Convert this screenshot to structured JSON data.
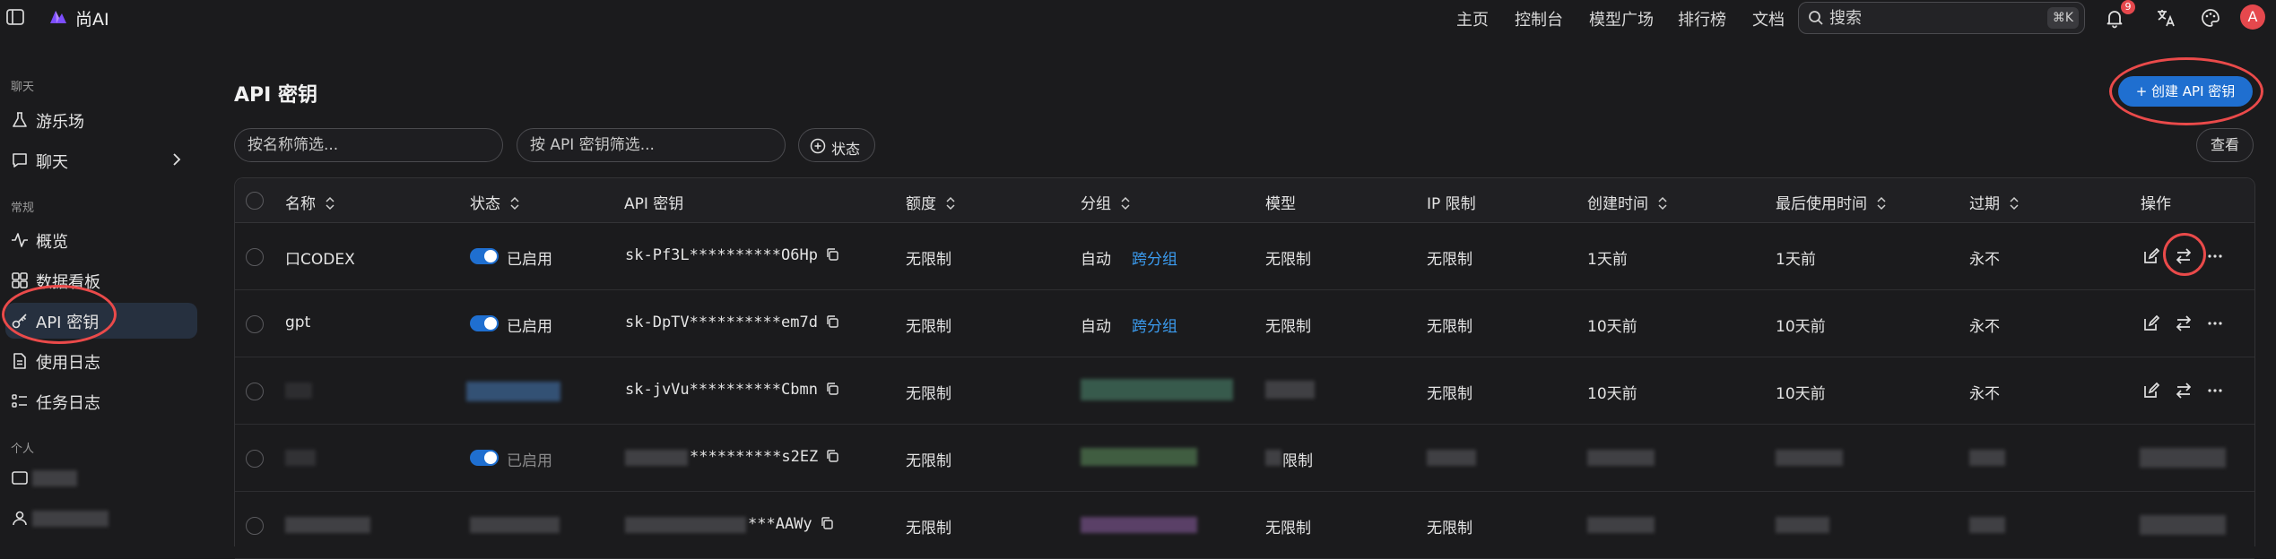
{
  "app": {
    "name": "尚AI"
  },
  "nav": [
    "主页",
    "控制台",
    "模型广场",
    "排行榜",
    "文档"
  ],
  "search": {
    "placeholder": "搜索",
    "shortcut": "⌘K"
  },
  "notifications": {
    "count": "9"
  },
  "user": {
    "avatar_letter": "A"
  },
  "sidebar": {
    "sections": {
      "chat": "聊天",
      "general": "常规",
      "personal": "个人"
    },
    "items": [
      {
        "label": "游乐场",
        "icon": "flask-icon"
      },
      {
        "label": "聊天",
        "icon": "chat-icon"
      },
      {
        "label": "概览",
        "icon": "activity-icon"
      },
      {
        "label": "数据看板",
        "icon": "dashboard-icon"
      },
      {
        "label": "API 密钥",
        "icon": "key-icon"
      },
      {
        "label": "使用日志",
        "icon": "log-icon"
      },
      {
        "label": "任务日志",
        "icon": "task-list-icon"
      }
    ]
  },
  "page": {
    "title": "API 密钥",
    "create_button": "+ 创建 API 密钥",
    "filters": {
      "name_placeholder": "按名称筛选...",
      "key_placeholder": "按 API 密钥筛选...",
      "status_label": "状态"
    },
    "view_button": "查看"
  },
  "table": {
    "columns": [
      "名称",
      "状态",
      "API 密钥",
      "额度",
      "分组",
      "模型",
      "IP 限制",
      "创建时间",
      "最后使用时间",
      "过期",
      "操作"
    ],
    "rows": [
      {
        "name": "口CODEX",
        "status": "已启用",
        "key": "sk-Pf3L**********O6Hp",
        "quota": "无限制",
        "group": "自动",
        "group_link": "跨分组",
        "model": "无限制",
        "ip": "无限制",
        "created": "1天前",
        "last_used": "1天前",
        "expires": "永不"
      },
      {
        "name": "gpt",
        "status": "已启用",
        "key": "sk-DpTV**********em7d",
        "quota": "无限制",
        "group": "自动",
        "group_link": "跨分组",
        "model": "无限制",
        "ip": "无限制",
        "created": "10天前",
        "last_used": "10天前",
        "expires": "永不"
      },
      {
        "name": "",
        "status": "",
        "key": "sk-jvVu**********Cbmn",
        "quota": "无限制",
        "group": "",
        "group_link": "",
        "model": "",
        "ip": "无限制",
        "created": "10天前",
        "last_used": "10天前",
        "expires": "永不"
      },
      {
        "name": "",
        "status": "已启用",
        "key": "**********s2EZ",
        "quota": "无限制",
        "group": "",
        "group_link": "",
        "model": "限制",
        "ip": "",
        "created": "",
        "last_used": "",
        "expires": ""
      },
      {
        "name": "",
        "status": "",
        "key": "***AAWy",
        "quota": "无限制",
        "group": "",
        "group_link": "",
        "model": "无限制",
        "ip": "无限制",
        "created": "",
        "last_used": "",
        "expires": ""
      }
    ]
  },
  "colors": {
    "accent": "#1f6fd0",
    "highlight": "#ea4a4a",
    "link": "#3b9cf0"
  }
}
